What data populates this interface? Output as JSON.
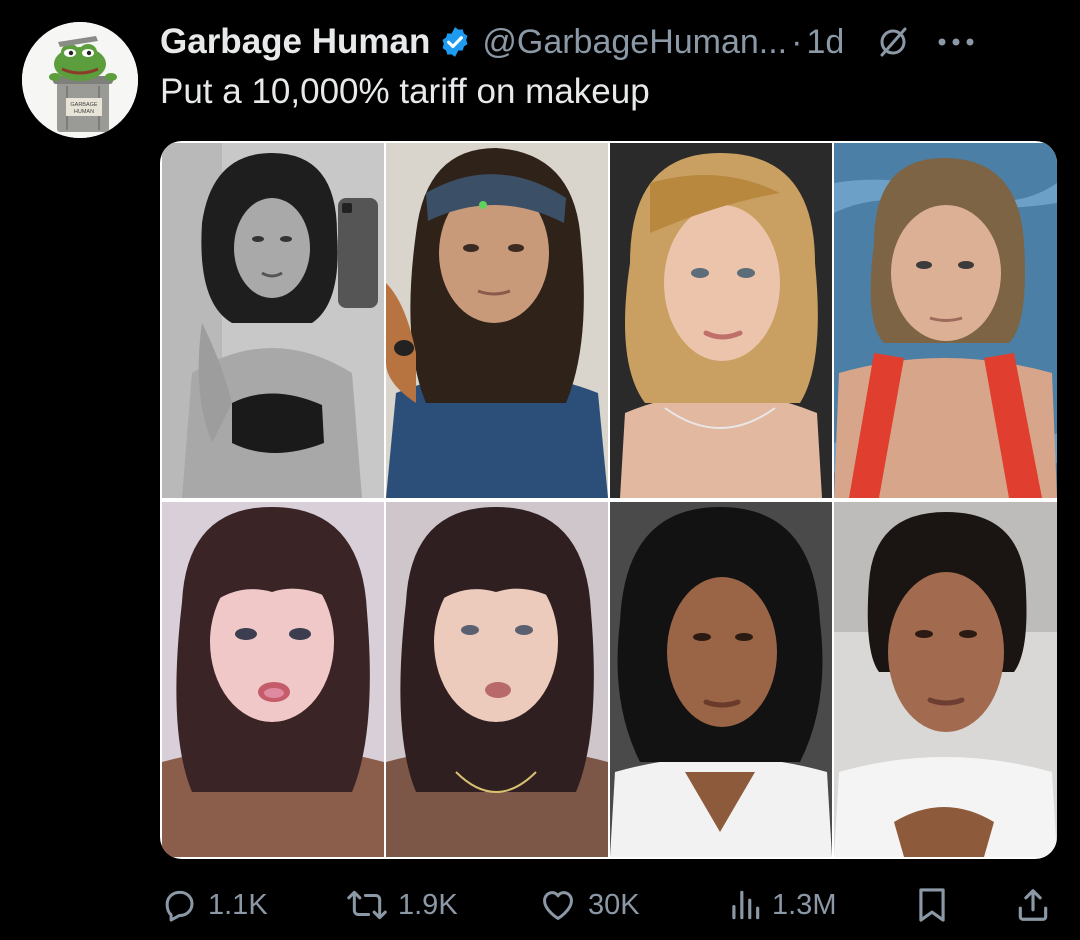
{
  "author": {
    "display_name": "Garbage Human",
    "handle": "@GarbageHuman...",
    "separator": "·",
    "time": "1d",
    "avatar_icon": "pepe-in-garbage-can-avatar",
    "avatar_can_text": "GARBAGE HUMAN"
  },
  "tweet": {
    "text": "Put a 10,000% tariff on makeup"
  },
  "media": {
    "photos": [
      {
        "name": "photo-1",
        "desc_icon": "woman-dark-hair-mirror-selfie"
      },
      {
        "name": "photo-2",
        "desc_icon": "woman-headband-no-makeup"
      },
      {
        "name": "photo-3",
        "desc_icon": "blonde-woman-makeup"
      },
      {
        "name": "photo-4",
        "desc_icon": "blonde-woman-swimsuit-no-makeup"
      },
      {
        "name": "photo-5",
        "desc_icon": "woman-bangs-makeup"
      },
      {
        "name": "photo-6",
        "desc_icon": "woman-bangs-no-makeup"
      },
      {
        "name": "photo-7",
        "desc_icon": "woman-curly-hair-makeup"
      },
      {
        "name": "photo-8",
        "desc_icon": "woman-no-makeup"
      }
    ]
  },
  "actions": {
    "reply_count": "1.1K",
    "repost_count": "1.9K",
    "like_count": "30K",
    "views_count": "1.3M"
  },
  "colors": {
    "background": "#000000",
    "text_primary": "#e7e9ea",
    "text_secondary": "#8b98a5",
    "verified_blue": "#1d9bf0"
  }
}
